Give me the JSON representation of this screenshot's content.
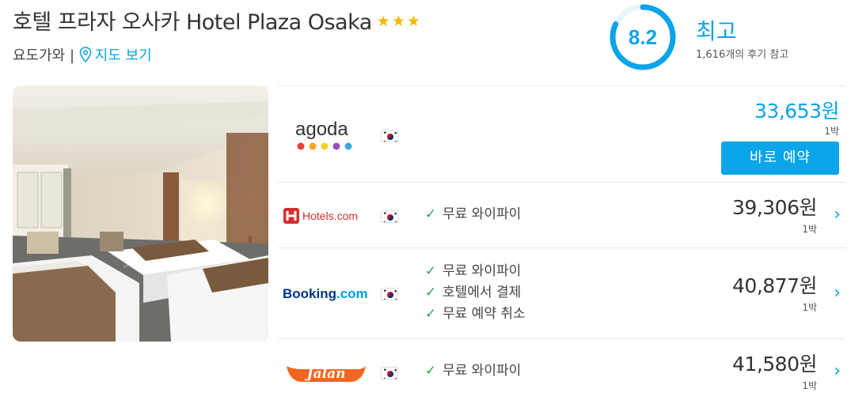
{
  "hotel": {
    "title": "호텔 프라자 오사카 Hotel Plaza Osaka",
    "stars": "★★★",
    "area": "요도가와 |",
    "map_link": "지도 보기"
  },
  "rating": {
    "score": "8.2",
    "score_fraction": 0.82,
    "label": "최고",
    "reviews": "1,616개의 후기 참고",
    "accent": "#0aa4e8"
  },
  "offers": [
    {
      "provider": "agoda",
      "flag": "kr-flag-icon",
      "features": [],
      "price": "33,653원",
      "nights": "1박",
      "button": "바로 예약"
    },
    {
      "provider": "Hotels.com",
      "flag": "kr-flag-icon",
      "features": [
        "무료 와이파이"
      ],
      "price": "39,306원",
      "nights": "1박"
    },
    {
      "provider": "Booking.com",
      "flag": "kr-flag-icon",
      "features": [
        "무료 와이파이",
        "호텔에서 결제",
        "무료 예약 취소"
      ],
      "price": "40,877원",
      "nights": "1박"
    },
    {
      "provider": "Jalan",
      "flag": "kr-flag-icon",
      "features": [
        "무료 와이파이"
      ],
      "price": "41,580원",
      "nights": "1박"
    }
  ],
  "logo_text": {
    "agoda": "agoda",
    "hotels": "Hotels.com",
    "booking_a": "Booking",
    "booking_b": ".com",
    "jalan": "Jalan"
  },
  "colors": {
    "accent": "#0aa4e8",
    "check": "#2aa54d",
    "star": "#f5b800",
    "hotels_red": "#d32f2f",
    "booking_navy": "#003580",
    "jalan_orange": "#f26522"
  }
}
